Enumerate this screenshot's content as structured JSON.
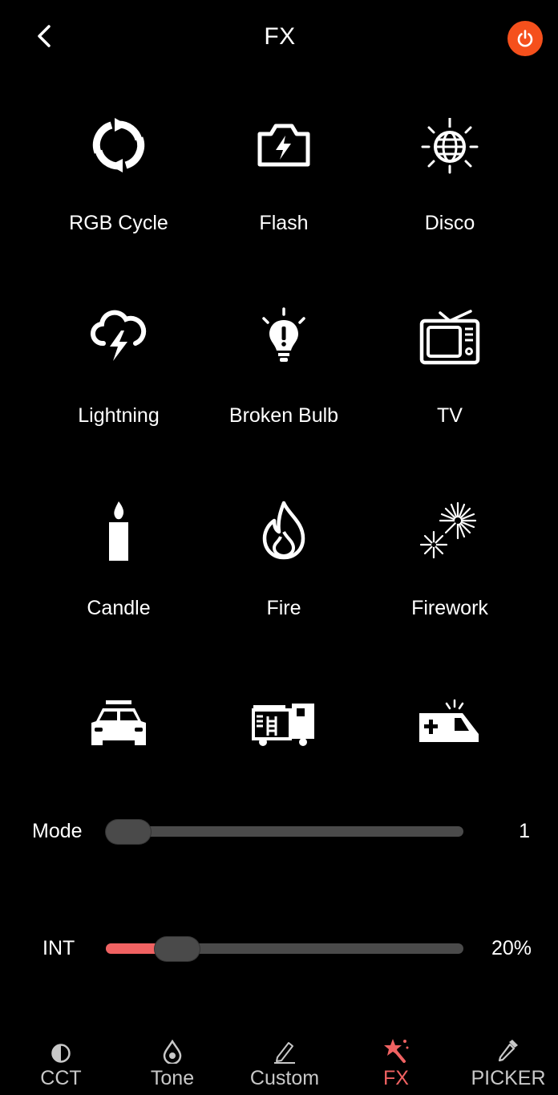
{
  "header": {
    "title": "FX"
  },
  "effects": [
    {
      "label": "RGB Cycle",
      "icon": "rgb-cycle-icon"
    },
    {
      "label": "Flash",
      "icon": "flash-icon"
    },
    {
      "label": "Disco",
      "icon": "disco-ball-icon"
    },
    {
      "label": "Lightning",
      "icon": "lightning-cloud-icon"
    },
    {
      "label": "Broken Bulb",
      "icon": "broken-bulb-icon"
    },
    {
      "label": "TV",
      "icon": "tv-icon"
    },
    {
      "label": "Candle",
      "icon": "candle-icon"
    },
    {
      "label": "Fire",
      "icon": "fire-icon"
    },
    {
      "label": "Firework",
      "icon": "firework-icon"
    },
    {
      "label": "",
      "icon": "police-car-icon"
    },
    {
      "label": "",
      "icon": "fire-truck-icon"
    },
    {
      "label": "",
      "icon": "ambulance-icon"
    }
  ],
  "sliders": {
    "mode": {
      "label": "Mode",
      "value": "1",
      "level": 0.0
    },
    "int": {
      "label": "INT",
      "value": "20%",
      "level": 0.2
    }
  },
  "nav": {
    "items": [
      {
        "label": "CCT",
        "icon": "cct-half-circle-icon"
      },
      {
        "label": "Tone",
        "icon": "drop-icon"
      },
      {
        "label": "Custom",
        "icon": "pencil-icon"
      },
      {
        "label": "FX",
        "icon": "magic-wand-icon"
      },
      {
        "label": "PICKER",
        "icon": "eyedropper-icon"
      }
    ],
    "active": "FX"
  },
  "colors": {
    "accent": "#f06262",
    "power": "#f5501c",
    "track": "#4a4a4a"
  }
}
